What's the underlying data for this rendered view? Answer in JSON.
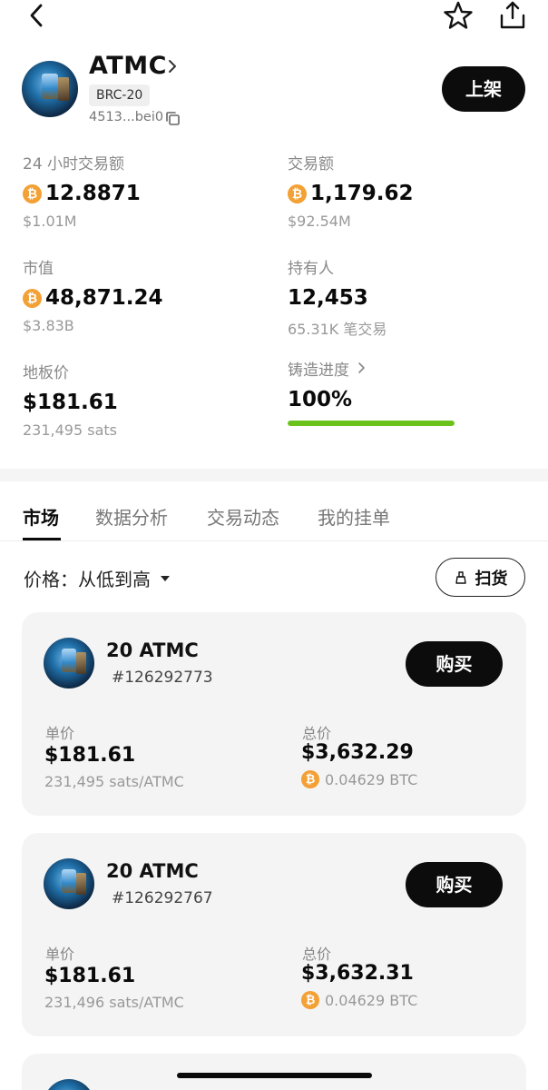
{
  "token": {
    "name": "ATMC",
    "standard": "BRC-20",
    "address": "4513...bei0",
    "list_button": "上架"
  },
  "stats": {
    "volume24h": {
      "label": "24 小时交易额",
      "value": "12.8871",
      "sub": "$1.01M"
    },
    "volume": {
      "label": "交易额",
      "value": "1,179.62",
      "sub": "$92.54M"
    },
    "market_cap": {
      "label": "市值",
      "value": "48,871.24",
      "sub": "$3.83B"
    },
    "holders": {
      "label": "持有人",
      "value": "12,453",
      "sub": "65.31K 笔交易"
    },
    "floor": {
      "label": "地板价",
      "value": "$181.61",
      "sub": "231,495 sats"
    },
    "mint": {
      "label": "铸造进度",
      "value": "100%",
      "progress": 1.0
    }
  },
  "tabs": [
    "市场",
    "数据分析",
    "交易动态",
    "我的挂单"
  ],
  "sort": {
    "label": "价格：从低到高"
  },
  "sweep_button": "扫货",
  "listings": [
    {
      "qty": "20 ATMC",
      "id": "#126292773",
      "buy_label": "购买",
      "unit_label": "单价",
      "unit_price": "$181.61",
      "unit_sats": "231,495 sats/ATMC",
      "total_label": "总价",
      "total_price": "$3,632.29",
      "total_btc": "0.04629 BTC"
    },
    {
      "qty": "20 ATMC",
      "id": "#126292767",
      "buy_label": "购买",
      "unit_label": "单价",
      "unit_price": "$181.61",
      "unit_sats": "231,496 sats/ATMC",
      "total_label": "总价",
      "total_price": "$3,632.31",
      "total_btc": "0.04629 BTC"
    }
  ],
  "colors": {
    "btc": "#f3a035",
    "progress": "#6bc21a",
    "primary": "#0c0c0c"
  }
}
